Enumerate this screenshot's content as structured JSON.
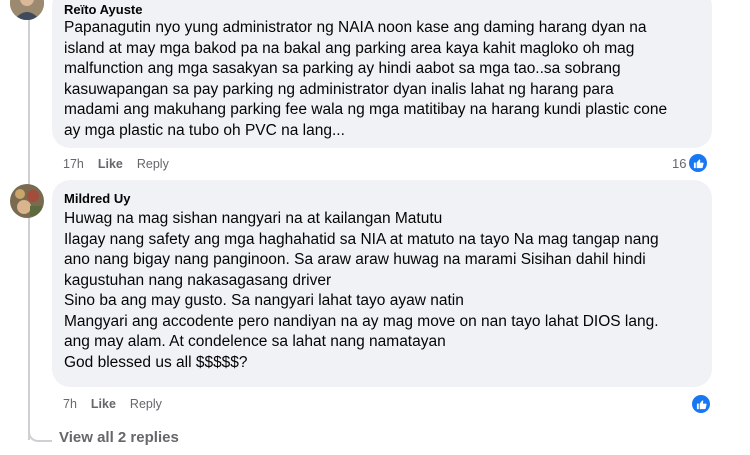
{
  "comment1": {
    "author": "Reïto Ayuste",
    "text": "Papanagutin nyo yung administrator ng NAIA noon kase ang daming harang dyan na\nisland at may mga bakod pa na bakal ang parking area kaya kahit magloko oh mag\nmalfunction ang mga sasakyan sa parking ay hindi aabot sa mga tao..sa sobrang\nkasuwapangan sa pay parking ng administrator dyan inalis lahat ng harang para\nmadami ang makuhang parking fee wala ng mga matitibay na harang kundi plastic cone\nay mga plastic na tubo oh PVC na lang...",
    "time": "17h",
    "like_label": "Like",
    "reply_label": "Reply",
    "reaction_count": "16",
    "reaction_icon": "thumbs-up-icon"
  },
  "comment2": {
    "author": "Mildred Uy",
    "text": "Huwag na mag sishan nangyari na at kailangan Matutu\nIlagay nang safety ang mga haghahatid sa NIA at matuto na tayo Na mag tangap nang\nano nang bigay nang panginoon. Sa araw araw huwag na marami Sisihan dahil hindi\nkagustuhan nang nakasagasang driver\nSino ba ang may gusto. Sa nangyari lahat tayo ayaw natin\nMangyari ang accodente pero nandiyan na ay mag move on nan tayo lahat DIOS lang.\nang may alam. At condelence sa lahat nang namatayan\nGod blessed us all $$$$$?",
    "time": "7h",
    "like_label": "Like",
    "reply_label": "Reply",
    "reaction_icon": "thumbs-up-icon"
  },
  "view_replies_label": "View all 2 replies",
  "colors": {
    "bubble": "#f0f2f5",
    "secondary_text": "#65676b",
    "like_blue": "#1877f2",
    "thread_line": "#ced0d4"
  }
}
